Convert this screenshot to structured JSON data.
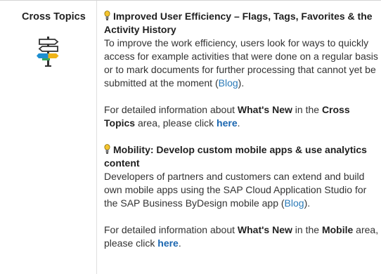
{
  "topic": {
    "label": "Cross Topics",
    "icon": "signpost-icon"
  },
  "sections": [
    {
      "title": "Improved User Efficiency – Flags, Tags, Favorites & the Activity History",
      "title_icon": "lightbulb-icon",
      "body": "To improve the work efficiency, users look for ways to quickly access for example activities that were done on a regular basis or to mark documents for further processing that cannot yet be submitted at the moment (",
      "link_text": "Blog",
      "body_end": ").",
      "details": {
        "prefix": "For detailed information about ",
        "whats_new": "What's New",
        "middle": " in the ",
        "area": "Cross Topics",
        "suffix_before_link": " area, please click ",
        "link_text": "here",
        "end": "."
      }
    },
    {
      "title": "Mobility: Develop custom mobile apps & use analytics content",
      "title_icon": "lightbulb-icon",
      "body": "Developers of partners and customers can extend and build own mobile apps using the SAP Cloud Application Studio for the SAP Business ByDesign mobile app (",
      "link_text": "Blog",
      "body_end": ").",
      "details": {
        "prefix": "For detailed information about ",
        "whats_new": "What's New",
        "middle": " in the ",
        "area": "Mobile",
        "suffix_before_link": " area, please click ",
        "link_text": "here",
        "end": "."
      }
    }
  ],
  "colors": {
    "link": "#2a7ab8",
    "border": "#d4d4d4",
    "sign_blue": "#1e8fd0",
    "sign_yellow": "#f0b418",
    "sign_green": "#3aa65b",
    "bulb_yellow": "#f4c430"
  }
}
